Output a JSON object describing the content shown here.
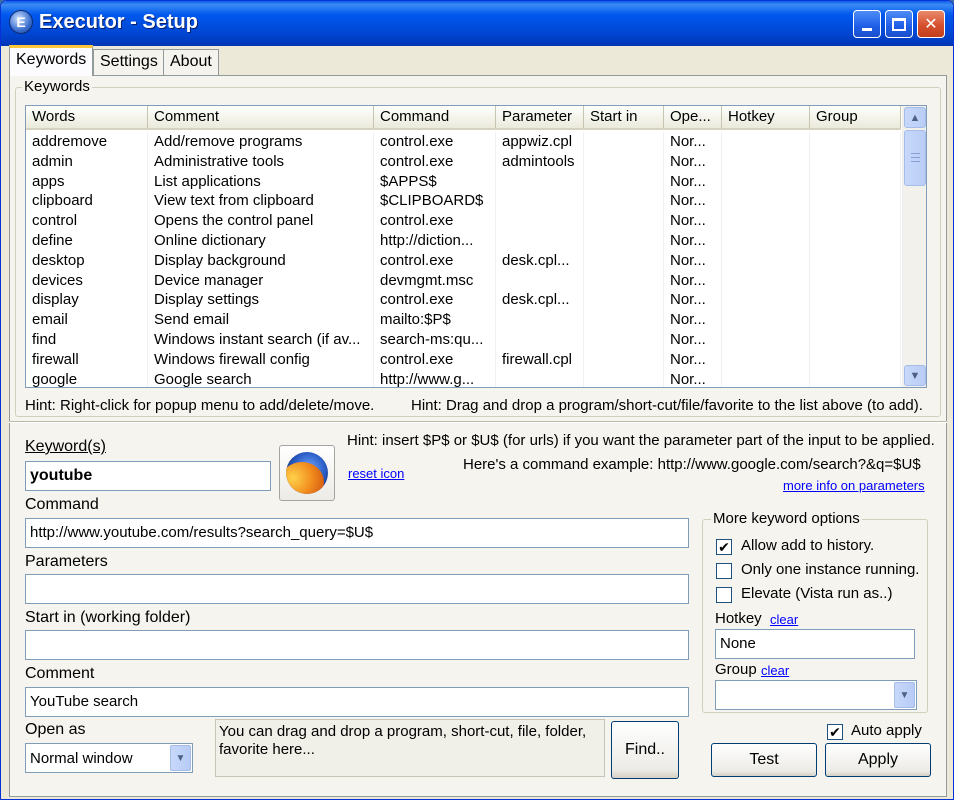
{
  "window": {
    "title": "Executor - Setup",
    "app_icon_glyph": "E",
    "controls": [
      "minimize",
      "maximize",
      "close"
    ]
  },
  "tabs": [
    {
      "label": "Keywords",
      "active": true
    },
    {
      "label": "Settings",
      "active": false
    },
    {
      "label": "About",
      "active": false
    }
  ],
  "keywords_group": {
    "label": "Keywords",
    "columns": [
      "Words",
      "Comment",
      "Command",
      "Parameter",
      "Start in",
      "Ope...",
      "Hotkey",
      "Group"
    ],
    "rows": [
      [
        "addremove",
        "Add/remove programs",
        "control.exe",
        "appwiz.cpl",
        "",
        "Nor...",
        "",
        ""
      ],
      [
        "admin",
        "Administrative tools",
        "control.exe",
        "admintools",
        "",
        "Nor...",
        "",
        ""
      ],
      [
        "apps",
        "List applications",
        "$APPS$",
        "",
        "",
        "Nor...",
        "",
        ""
      ],
      [
        "clipboard",
        "View text from clipboard",
        "$CLIPBOARD$",
        "",
        "",
        "Nor...",
        "",
        ""
      ],
      [
        "control",
        "Opens the control panel",
        "control.exe",
        "",
        "",
        "Nor...",
        "",
        ""
      ],
      [
        "define",
        "Online dictionary",
        "http://diction...",
        "",
        "",
        "Nor...",
        "",
        ""
      ],
      [
        "desktop",
        "Display background",
        "control.exe",
        "desk.cpl...",
        "",
        "Nor...",
        "",
        ""
      ],
      [
        "devices",
        "Device manager",
        "devmgmt.msc",
        "",
        "",
        "Nor...",
        "",
        ""
      ],
      [
        "display",
        "Display settings",
        "control.exe",
        "desk.cpl...",
        "",
        "Nor...",
        "",
        ""
      ],
      [
        "email",
        "Send email",
        "mailto:$P$",
        "",
        "",
        "Nor...",
        "",
        ""
      ],
      [
        "find",
        "Windows instant search (if av...",
        "search-ms:qu...",
        "",
        "",
        "Nor...",
        "",
        ""
      ],
      [
        "firewall",
        "Windows firewall config",
        "control.exe",
        "firewall.cpl",
        "",
        "Nor...",
        "",
        ""
      ],
      [
        "google",
        "Google search",
        "http://www.g...",
        "",
        "",
        "Nor...",
        "",
        ""
      ]
    ],
    "hint_left": "Hint: Right-click for popup menu to add/delete/move.",
    "hint_right": "Hint: Drag and drop a program/short-cut/file/favorite to the list above (to add)."
  },
  "editor": {
    "keyword_label": "Keyword(s)",
    "keyword_value": "youtube",
    "reset_icon_link": "reset icon",
    "hint_param": "Hint: insert $P$ or $U$ (for urls) if you want the parameter part of the input to be applied.",
    "hint_example": "Here's a command example: http://www.google.com/search?&q=$U$",
    "more_info_link": "more info on parameters",
    "command_label": "Command",
    "command_value": "http://www.youtube.com/results?search_query=$U$",
    "parameters_label": "Parameters",
    "parameters_value": "",
    "startin_label": "Start in (working folder)",
    "startin_value": "",
    "comment_label": "Comment",
    "comment_value": "YouTube search",
    "openas_label": "Open as",
    "openas_value": "Normal window",
    "dropzone_text": "You can drag and drop a program, short-cut, file, folder, favorite here...",
    "find_button": "Find.."
  },
  "more_options": {
    "label": "More keyword options",
    "allow_history": {
      "label": "Allow add to history.",
      "checked": true,
      "mark": "✔"
    },
    "only_one": {
      "label": "Only one instance running.",
      "checked": false
    },
    "elevate": {
      "label": "Elevate (Vista run as..)",
      "checked": false
    },
    "hotkey_label": "Hotkey",
    "hotkey_clear": "clear",
    "hotkey_value": "None",
    "group_label": "Group",
    "group_clear": "clear",
    "group_value": ""
  },
  "footer": {
    "auto_apply": {
      "label": "Auto apply",
      "checked": true,
      "mark": "✔"
    },
    "test_button": "Test",
    "apply_button": "Apply"
  }
}
